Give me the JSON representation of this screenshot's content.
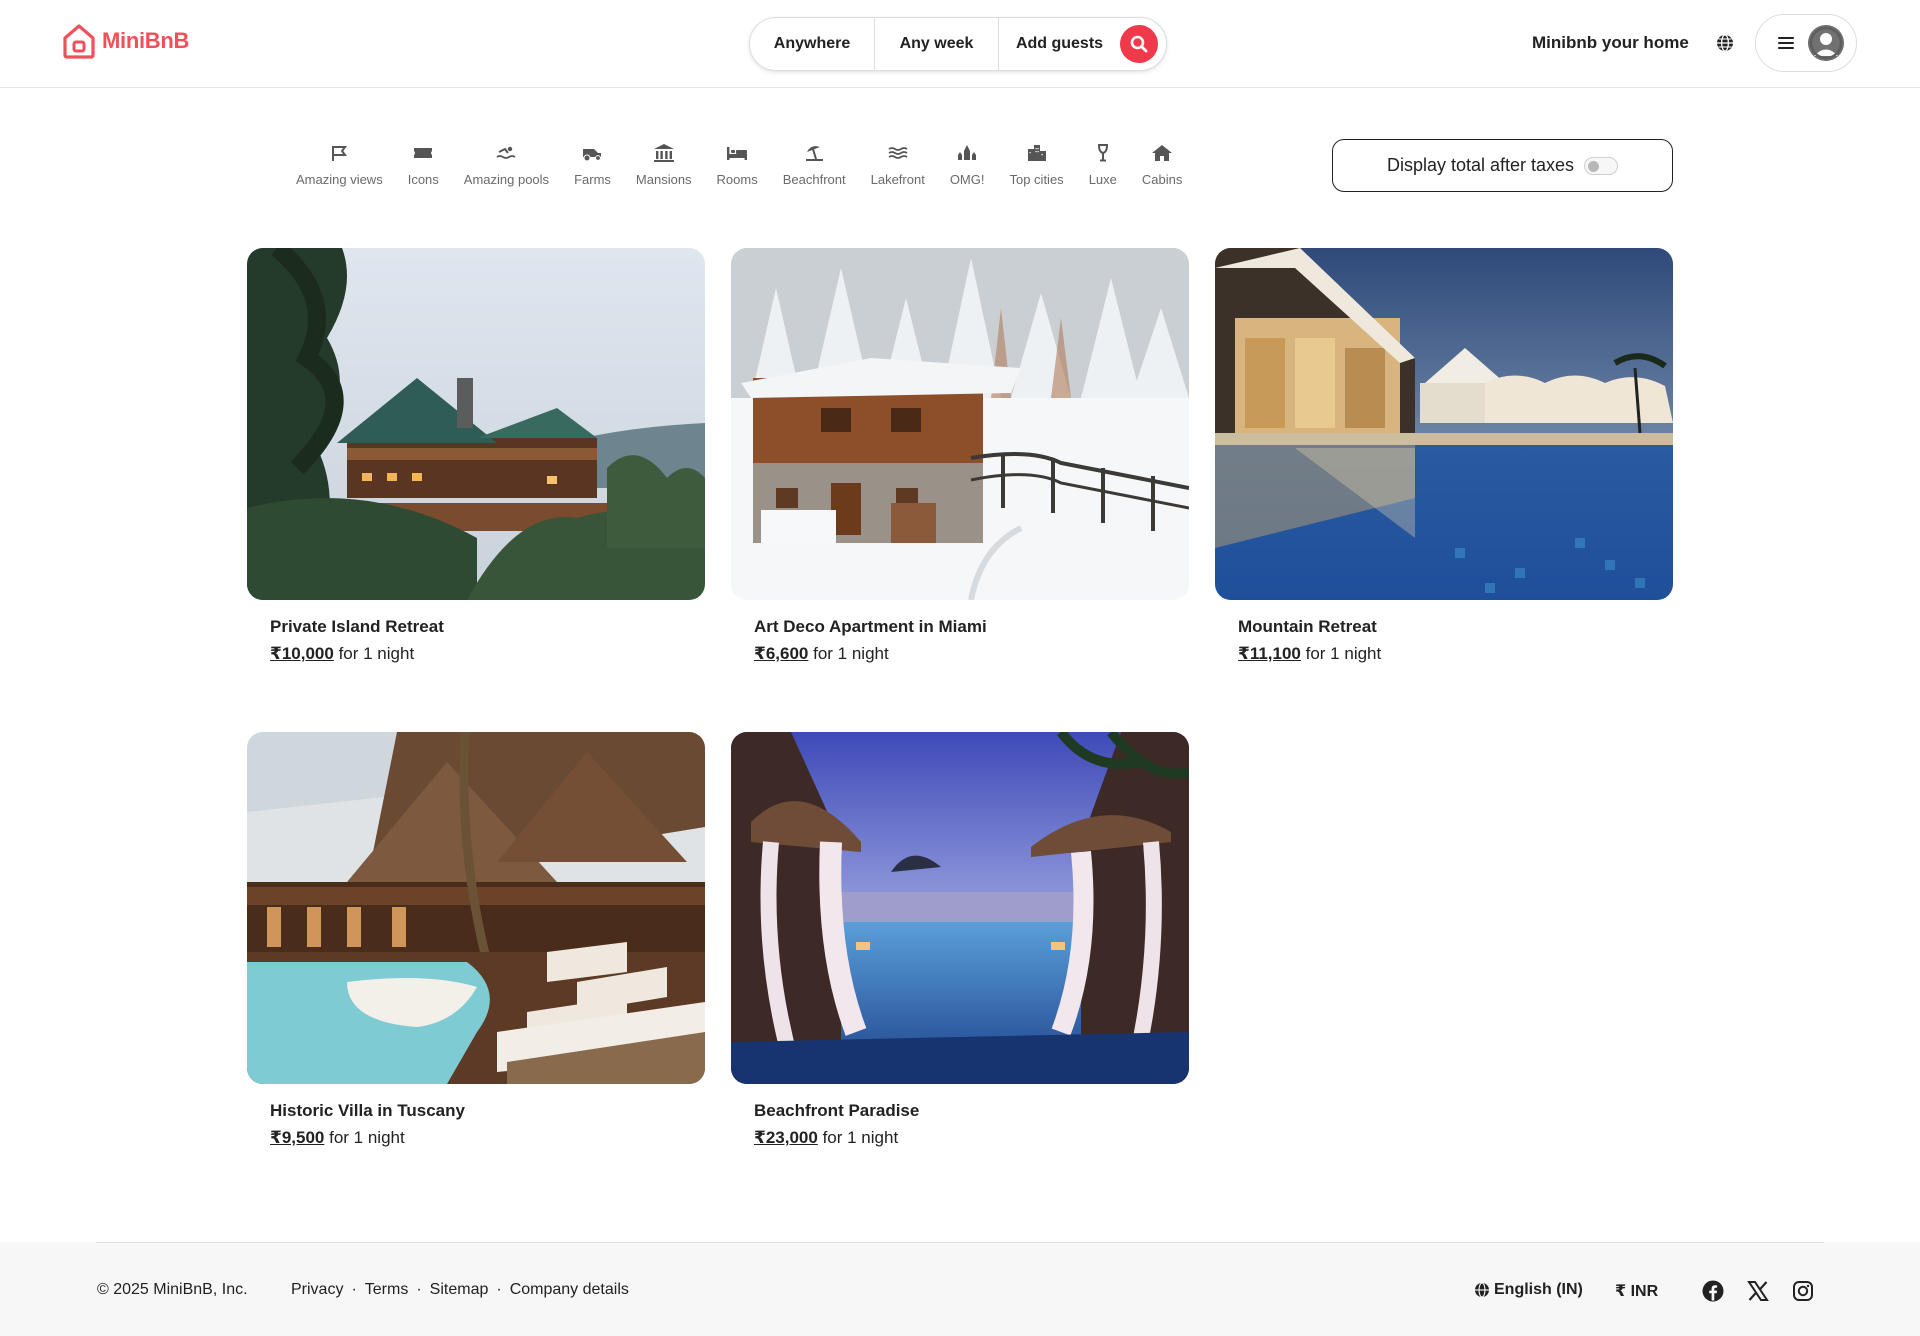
{
  "brand": {
    "name": "MiniBnB",
    "color": "#f0505a"
  },
  "search": {
    "where": "Anywhere",
    "when": "Any week",
    "who": "Add guests",
    "accent": "#f0394a"
  },
  "header": {
    "host_label": "Minibnb your home",
    "globe_icon": "globe-icon",
    "menu_icon": "hamburger-icon",
    "avatar_icon": "user-avatar-icon"
  },
  "categories": [
    {
      "label": "Amazing views",
      "icon": "flag-icon"
    },
    {
      "label": "Icons",
      "icon": "ticket-icon"
    },
    {
      "label": "Amazing pools",
      "icon": "swimmer-icon"
    },
    {
      "label": "Farms",
      "icon": "tractor-icon"
    },
    {
      "label": "Mansions",
      "icon": "bank-icon"
    },
    {
      "label": "Rooms",
      "icon": "bed-icon"
    },
    {
      "label": "Beachfront",
      "icon": "umbrella-beach-icon"
    },
    {
      "label": "Lakefront",
      "icon": "water-icon"
    },
    {
      "label": "OMG!",
      "icon": "castle-icon"
    },
    {
      "label": "Top cities",
      "icon": "city-icon"
    },
    {
      "label": "Luxe",
      "icon": "wine-glass-icon"
    },
    {
      "label": "Cabins",
      "icon": "home-icon"
    }
  ],
  "tax_toggle": {
    "label": "Display total after taxes",
    "enabled": false
  },
  "listings": [
    {
      "title": "Private Island Retreat",
      "price": "₹10,000",
      "suffix": "for 1 night",
      "image": "wooden lodge among trees"
    },
    {
      "title": "Art Deco Apartment in Miami",
      "price": "₹6,600",
      "suffix": "for 1 night",
      "image": "snowy chalet"
    },
    {
      "title": "Mountain Retreat",
      "price": "₹11,100",
      "suffix": "for 1 night",
      "image": "resort pool at dusk"
    },
    {
      "title": "Historic Villa in Tuscany",
      "price": "₹9,500",
      "suffix": "for 1 night",
      "image": "beach resort with pool and loungers"
    },
    {
      "title": "Beachfront Paradise",
      "price": "₹23,000",
      "suffix": "for 1 night",
      "image": "infinity pool with cabanas at sunset"
    }
  ],
  "footer": {
    "copyright": "© 2025 MiniBnB, Inc.",
    "links": [
      "Privacy",
      "Terms",
      "Sitemap",
      "Company details"
    ],
    "language": "English (IN)",
    "currency": "₹ INR",
    "social": [
      "facebook-icon",
      "x-icon",
      "instagram-icon"
    ]
  }
}
